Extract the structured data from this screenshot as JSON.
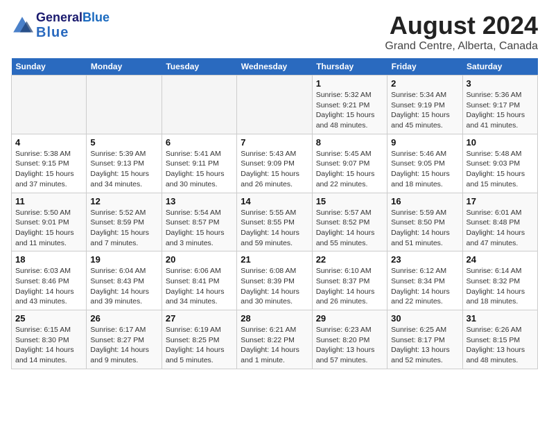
{
  "header": {
    "logo_line1": "General",
    "logo_line2": "Blue",
    "title": "August 2024",
    "subtitle": "Grand Centre, Alberta, Canada"
  },
  "days_of_week": [
    "Sunday",
    "Monday",
    "Tuesday",
    "Wednesday",
    "Thursday",
    "Friday",
    "Saturday"
  ],
  "weeks": [
    [
      {
        "num": "",
        "info": ""
      },
      {
        "num": "",
        "info": ""
      },
      {
        "num": "",
        "info": ""
      },
      {
        "num": "",
        "info": ""
      },
      {
        "num": "1",
        "info": "Sunrise: 5:32 AM\nSunset: 9:21 PM\nDaylight: 15 hours\nand 48 minutes."
      },
      {
        "num": "2",
        "info": "Sunrise: 5:34 AM\nSunset: 9:19 PM\nDaylight: 15 hours\nand 45 minutes."
      },
      {
        "num": "3",
        "info": "Sunrise: 5:36 AM\nSunset: 9:17 PM\nDaylight: 15 hours\nand 41 minutes."
      }
    ],
    [
      {
        "num": "4",
        "info": "Sunrise: 5:38 AM\nSunset: 9:15 PM\nDaylight: 15 hours\nand 37 minutes."
      },
      {
        "num": "5",
        "info": "Sunrise: 5:39 AM\nSunset: 9:13 PM\nDaylight: 15 hours\nand 34 minutes."
      },
      {
        "num": "6",
        "info": "Sunrise: 5:41 AM\nSunset: 9:11 PM\nDaylight: 15 hours\nand 30 minutes."
      },
      {
        "num": "7",
        "info": "Sunrise: 5:43 AM\nSunset: 9:09 PM\nDaylight: 15 hours\nand 26 minutes."
      },
      {
        "num": "8",
        "info": "Sunrise: 5:45 AM\nSunset: 9:07 PM\nDaylight: 15 hours\nand 22 minutes."
      },
      {
        "num": "9",
        "info": "Sunrise: 5:46 AM\nSunset: 9:05 PM\nDaylight: 15 hours\nand 18 minutes."
      },
      {
        "num": "10",
        "info": "Sunrise: 5:48 AM\nSunset: 9:03 PM\nDaylight: 15 hours\nand 15 minutes."
      }
    ],
    [
      {
        "num": "11",
        "info": "Sunrise: 5:50 AM\nSunset: 9:01 PM\nDaylight: 15 hours\nand 11 minutes."
      },
      {
        "num": "12",
        "info": "Sunrise: 5:52 AM\nSunset: 8:59 PM\nDaylight: 15 hours\nand 7 minutes."
      },
      {
        "num": "13",
        "info": "Sunrise: 5:54 AM\nSunset: 8:57 PM\nDaylight: 15 hours\nand 3 minutes."
      },
      {
        "num": "14",
        "info": "Sunrise: 5:55 AM\nSunset: 8:55 PM\nDaylight: 14 hours\nand 59 minutes."
      },
      {
        "num": "15",
        "info": "Sunrise: 5:57 AM\nSunset: 8:52 PM\nDaylight: 14 hours\nand 55 minutes."
      },
      {
        "num": "16",
        "info": "Sunrise: 5:59 AM\nSunset: 8:50 PM\nDaylight: 14 hours\nand 51 minutes."
      },
      {
        "num": "17",
        "info": "Sunrise: 6:01 AM\nSunset: 8:48 PM\nDaylight: 14 hours\nand 47 minutes."
      }
    ],
    [
      {
        "num": "18",
        "info": "Sunrise: 6:03 AM\nSunset: 8:46 PM\nDaylight: 14 hours\nand 43 minutes."
      },
      {
        "num": "19",
        "info": "Sunrise: 6:04 AM\nSunset: 8:43 PM\nDaylight: 14 hours\nand 39 minutes."
      },
      {
        "num": "20",
        "info": "Sunrise: 6:06 AM\nSunset: 8:41 PM\nDaylight: 14 hours\nand 34 minutes."
      },
      {
        "num": "21",
        "info": "Sunrise: 6:08 AM\nSunset: 8:39 PM\nDaylight: 14 hours\nand 30 minutes."
      },
      {
        "num": "22",
        "info": "Sunrise: 6:10 AM\nSunset: 8:37 PM\nDaylight: 14 hours\nand 26 minutes."
      },
      {
        "num": "23",
        "info": "Sunrise: 6:12 AM\nSunset: 8:34 PM\nDaylight: 14 hours\nand 22 minutes."
      },
      {
        "num": "24",
        "info": "Sunrise: 6:14 AM\nSunset: 8:32 PM\nDaylight: 14 hours\nand 18 minutes."
      }
    ],
    [
      {
        "num": "25",
        "info": "Sunrise: 6:15 AM\nSunset: 8:30 PM\nDaylight: 14 hours\nand 14 minutes."
      },
      {
        "num": "26",
        "info": "Sunrise: 6:17 AM\nSunset: 8:27 PM\nDaylight: 14 hours\nand 9 minutes."
      },
      {
        "num": "27",
        "info": "Sunrise: 6:19 AM\nSunset: 8:25 PM\nDaylight: 14 hours\nand 5 minutes."
      },
      {
        "num": "28",
        "info": "Sunrise: 6:21 AM\nSunset: 8:22 PM\nDaylight: 14 hours\nand 1 minute."
      },
      {
        "num": "29",
        "info": "Sunrise: 6:23 AM\nSunset: 8:20 PM\nDaylight: 13 hours\nand 57 minutes."
      },
      {
        "num": "30",
        "info": "Sunrise: 6:25 AM\nSunset: 8:17 PM\nDaylight: 13 hours\nand 52 minutes."
      },
      {
        "num": "31",
        "info": "Sunrise: 6:26 AM\nSunset: 8:15 PM\nDaylight: 13 hours\nand 48 minutes."
      }
    ]
  ]
}
